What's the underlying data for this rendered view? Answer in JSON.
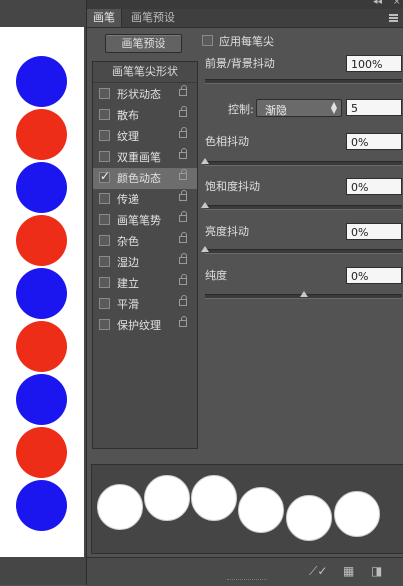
{
  "canvas": {
    "dot_colors": [
      "#1b16ef",
      "#ee2d18",
      "#1b16ef",
      "#ee2d18",
      "#1b16ef",
      "#ee2d18",
      "#1b16ef",
      "#ee2d18",
      "#1b16ef"
    ]
  },
  "panel": {
    "tabs": [
      {
        "label": "画笔",
        "active": true
      },
      {
        "label": "画笔预设",
        "active": false
      }
    ],
    "collapse_icon": "double-arrow-icon",
    "menu_icon": "panel-menu-icon",
    "preset_button": "画笔预设",
    "list_header": "画笔笔尖形状",
    "items": [
      {
        "label": "形状动态",
        "checked": false,
        "selected": false
      },
      {
        "label": "散布",
        "checked": false,
        "selected": false
      },
      {
        "label": "纹理",
        "checked": false,
        "selected": false
      },
      {
        "label": "双重画笔",
        "checked": false,
        "selected": false
      },
      {
        "label": "颜色动态",
        "checked": true,
        "selected": true
      },
      {
        "label": "传递",
        "checked": false,
        "selected": false
      },
      {
        "label": "画笔笔势",
        "checked": false,
        "selected": false
      },
      {
        "label": "杂色",
        "checked": false,
        "selected": false
      },
      {
        "label": "湿边",
        "checked": false,
        "selected": false
      },
      {
        "label": "建立",
        "checked": false,
        "selected": false
      },
      {
        "label": "平滑",
        "checked": false,
        "selected": false
      },
      {
        "label": "保护纹理",
        "checked": false,
        "selected": false
      }
    ],
    "apply_per_tip": {
      "label": "应用每笔尖",
      "checked": false
    },
    "fg_bg_jitter": {
      "label": "前景/背景抖动",
      "value": "100%",
      "slider_fraction": 1.0
    },
    "control": {
      "label": "控制:",
      "selected": "渐隐",
      "value": "5"
    },
    "hue_jitter": {
      "label": "色相抖动",
      "value": "0%",
      "slider_fraction": 0.0
    },
    "saturation_jitter": {
      "label": "饱和度抖动",
      "value": "0%",
      "slider_fraction": 0.0
    },
    "brightness_jitter": {
      "label": "亮度抖动",
      "value": "0%",
      "slider_fraction": 0.0
    },
    "purity": {
      "label": "纯度",
      "value": "0%",
      "slider_fraction": 0.5
    },
    "bottom_icons": [
      "brush-toggle-icon",
      "grid-icon",
      "new-preset-icon"
    ]
  }
}
